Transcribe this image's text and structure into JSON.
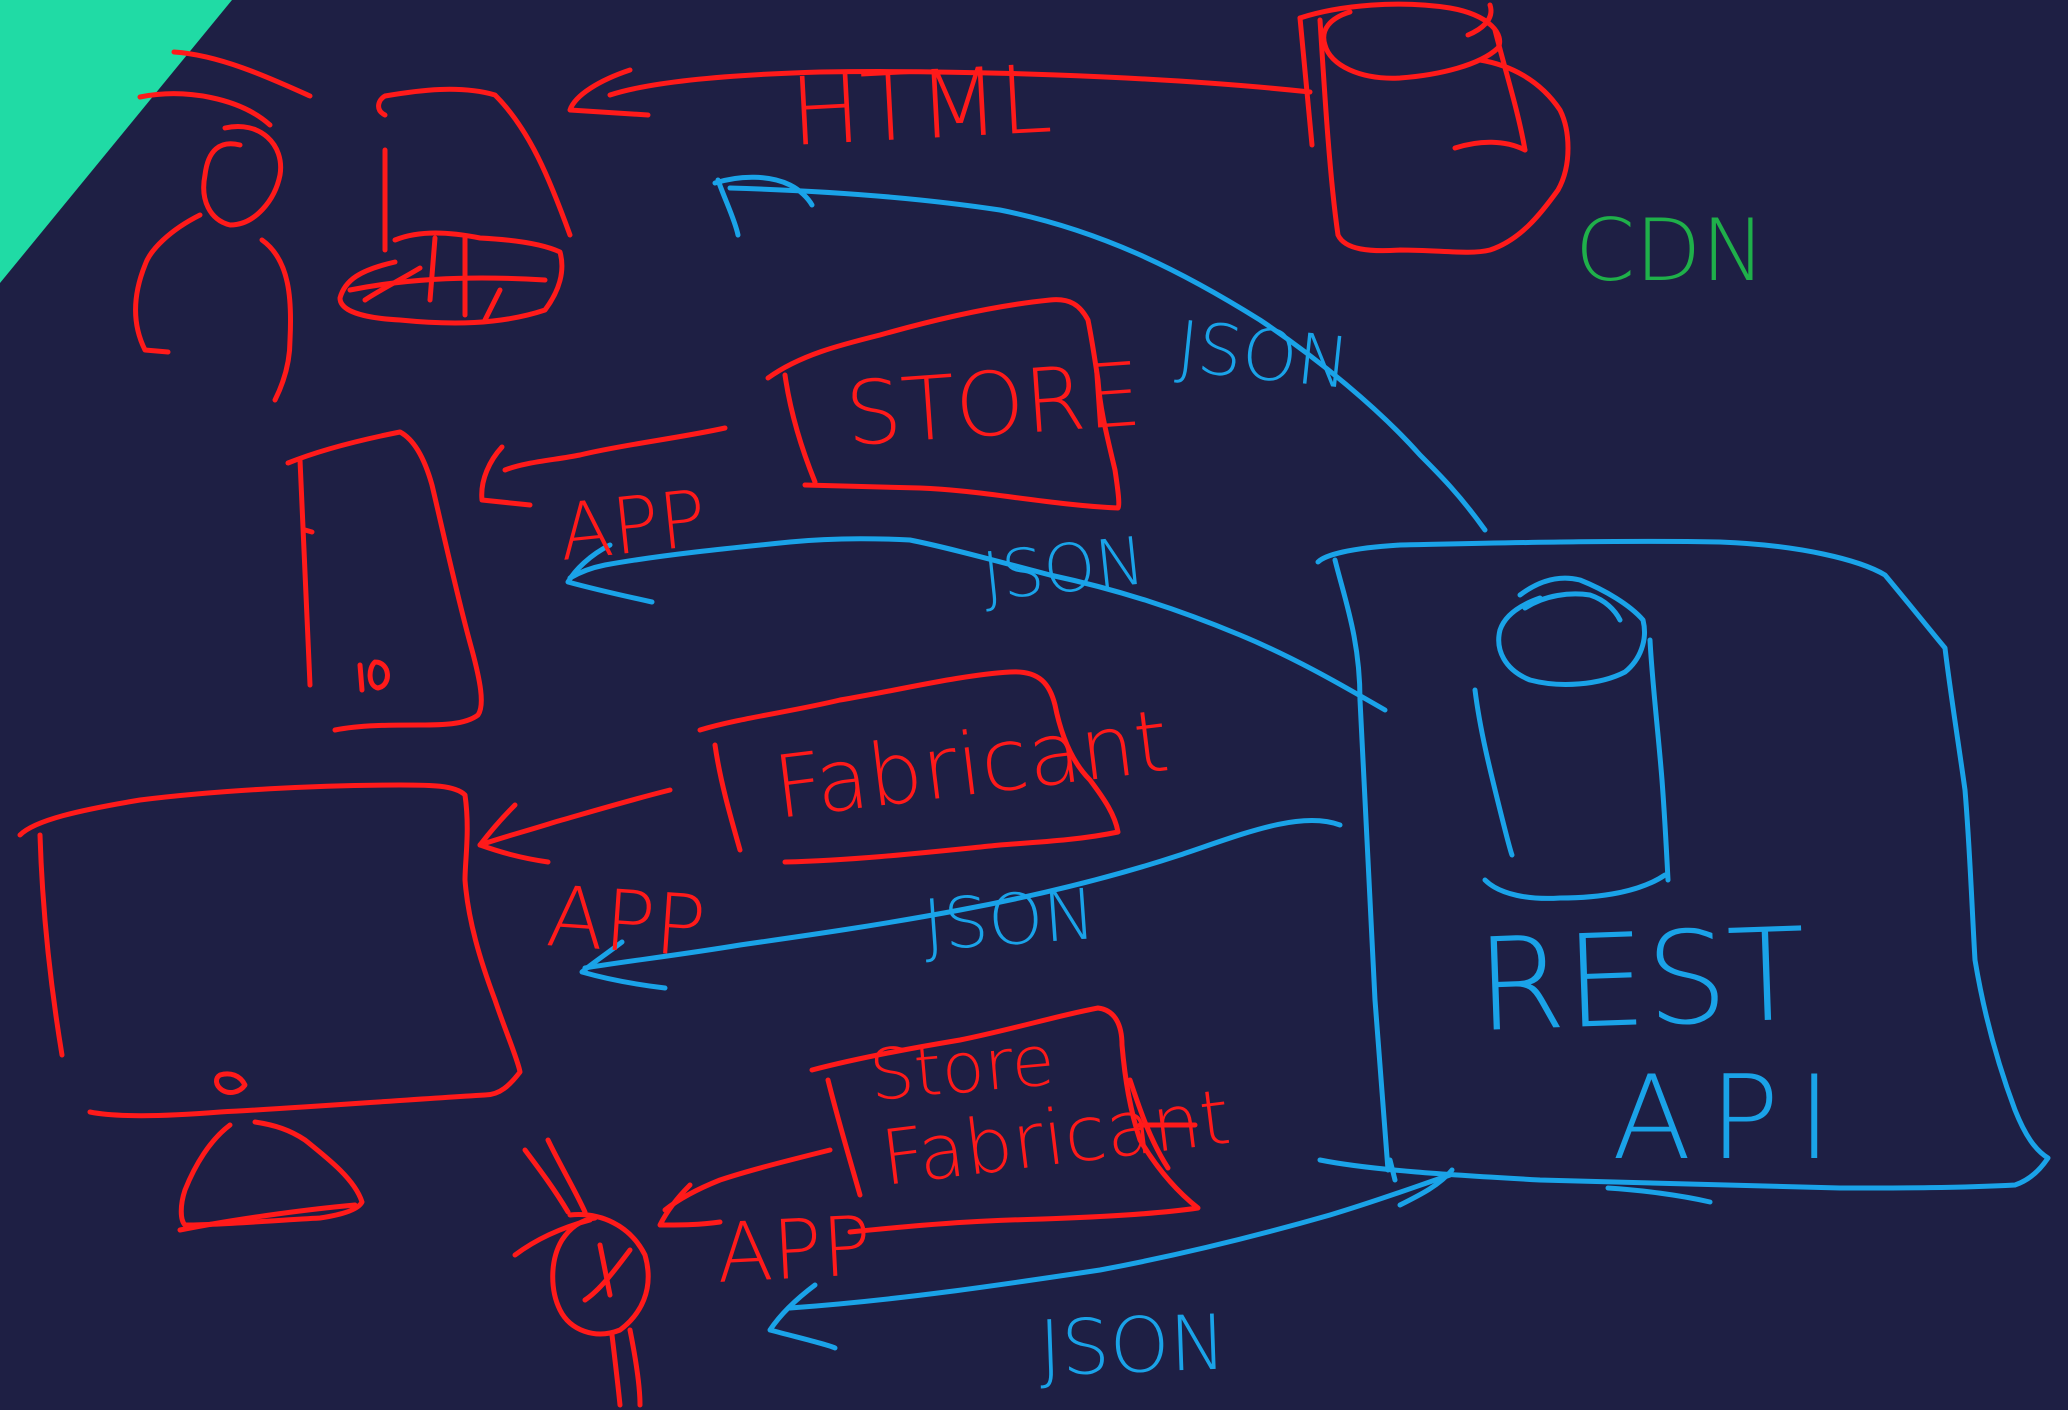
{
  "colors": {
    "background": "#1e1f44",
    "corner": "#20dba5",
    "client": "#ff1a1a",
    "api": "#1aa3e8",
    "cdn": "#1fb04a"
  },
  "labels": {
    "html": "HTML",
    "cdn": "CDN",
    "json_top": "JSON",
    "store": "STORE",
    "app_store": "APP",
    "json_store": "JSON",
    "fabricant": "Fabricant",
    "app_fabricant": "APP",
    "json_fabricant": "JSON",
    "store_line1": "Store",
    "store_line2": "Fabricant",
    "app_store_fabricant": "APP",
    "json_bottom": "JSON",
    "rest": "REST",
    "api": "API"
  }
}
